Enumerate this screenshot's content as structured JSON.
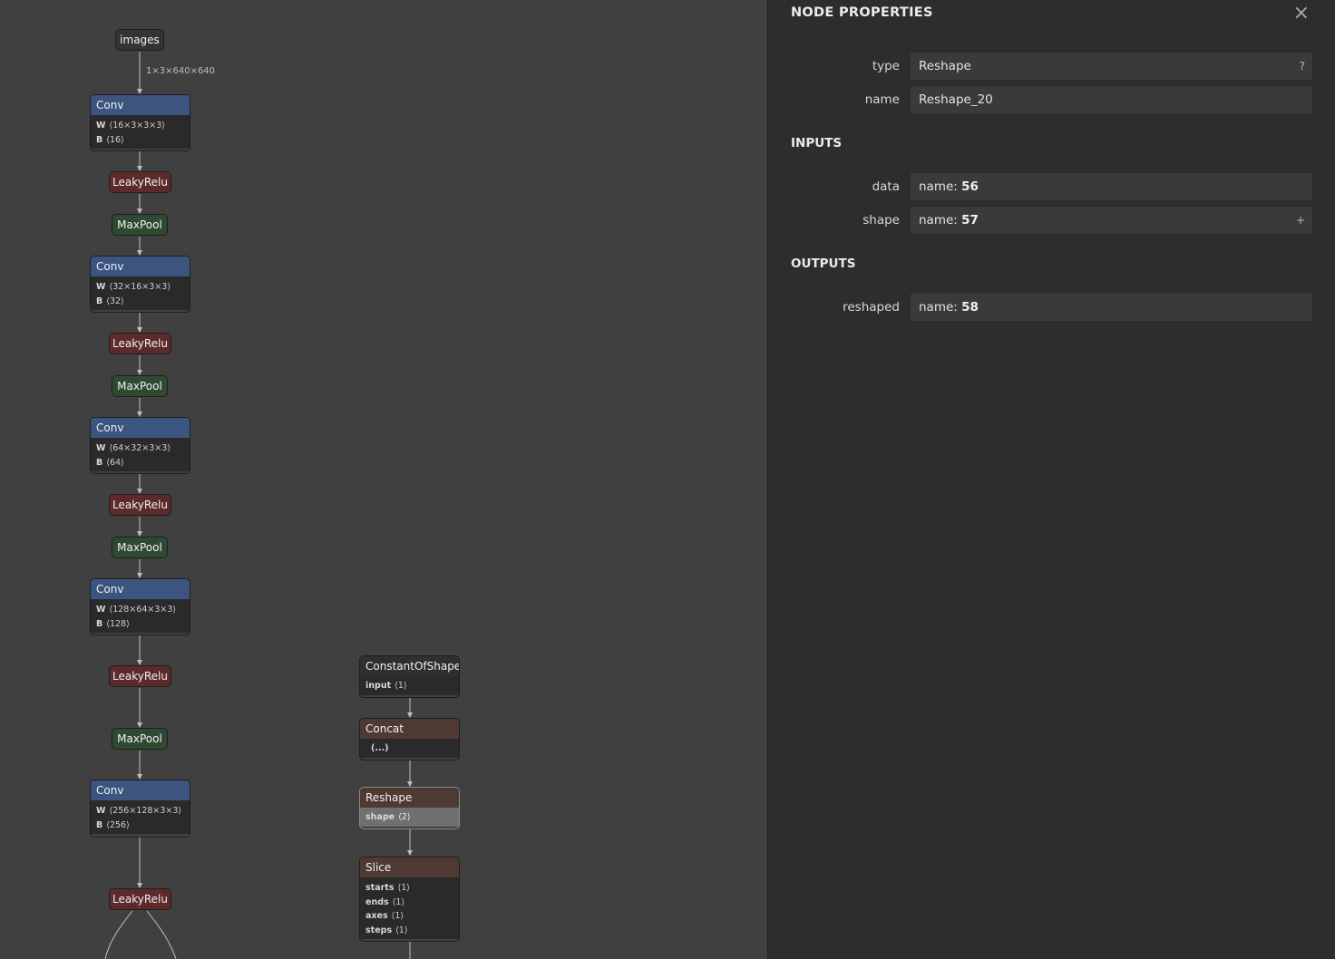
{
  "graph": {
    "input_node": "images",
    "edge_label": "1×3×640×640",
    "conv_blocks": [
      {
        "label": "Conv",
        "w_key": "W",
        "w": "⟨16×3×3×3⟩",
        "b_key": "B",
        "b": "⟨16⟩"
      },
      {
        "label": "Conv",
        "w_key": "W",
        "w": "⟨32×16×3×3⟩",
        "b_key": "B",
        "b": "⟨32⟩"
      },
      {
        "label": "Conv",
        "w_key": "W",
        "w": "⟨64×32×3×3⟩",
        "b_key": "B",
        "b": "⟨64⟩"
      },
      {
        "label": "Conv",
        "w_key": "W",
        "w": "⟨128×64×3×3⟩",
        "b_key": "B",
        "b": "⟨128⟩"
      },
      {
        "label": "Conv",
        "w_key": "W",
        "w": "⟨256×128×3×3⟩",
        "b_key": "B",
        "b": "⟨256⟩"
      }
    ],
    "relu_label": "LeakyRelu",
    "pool_label": "MaxPool",
    "constantofshape": {
      "label": "ConstantOfShape",
      "key": "input",
      "val": "⟨1⟩"
    },
    "concat": {
      "label": "Concat",
      "val": "(...)"
    },
    "reshape": {
      "label": "Reshape",
      "key": "shape",
      "val": "⟨2⟩"
    },
    "slice": {
      "label": "Slice",
      "rows": [
        {
          "key": "starts",
          "val": "⟨1⟩"
        },
        {
          "key": "ends",
          "val": "⟨1⟩"
        },
        {
          "key": "axes",
          "val": "⟨1⟩"
        },
        {
          "key": "steps",
          "val": "⟨1⟩"
        }
      ]
    }
  },
  "panel": {
    "title": "NODE PROPERTIES",
    "close_icon": "×",
    "type_label": "type",
    "type_value": "Reshape",
    "type_help": "?",
    "name_label": "name",
    "name_value": "Reshape_20",
    "inputs_title": "INPUTS",
    "inputs": [
      {
        "label": "data",
        "prefix": "name: ",
        "value": "56"
      },
      {
        "label": "shape",
        "prefix": "name: ",
        "value": "57",
        "expand": "+"
      }
    ],
    "outputs_title": "OUTPUTS",
    "outputs": [
      {
        "label": "reshaped",
        "prefix": "name: ",
        "value": "58"
      }
    ]
  },
  "colors": {
    "conv": "#3b5480",
    "leakyrelu": "#5c2a2a",
    "maxpool": "#2f4a33",
    "data_op": "#4f3a33",
    "canvas": "#404040",
    "panel": "#2d2d2d"
  }
}
